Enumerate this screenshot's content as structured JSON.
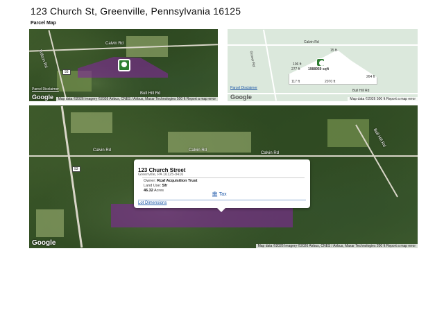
{
  "header": {
    "title": "123 Church St, Greenville, Pennsylvania 16125",
    "subtitle": "Parcel Map"
  },
  "map1": {
    "road_labels": [
      "Calvin Rd",
      "Bull Hill Rd",
      "Wilson Rd"
    ],
    "shield": "93",
    "disclaimer": "Parcel Disclaimer",
    "google": "Google",
    "attribution": "Map data ©2026 Imagery ©2026 Airbus, CNES / Airbus, Maxar Technologies   500 ft   Report a map error"
  },
  "map2": {
    "road_labels": [
      "Calvin Rd",
      "Bull Hill Rd",
      "Grover Rd"
    ],
    "dimensions": [
      "15 ft",
      "106 ft",
      "277 ft",
      "1988959 sqft",
      "2070 ft",
      "117 ft",
      "264 ft"
    ],
    "disclaimer": "Parcel Disclaimer",
    "google": "Google",
    "attribution": "Map data ©2026   500 ft   Report a map error"
  },
  "map3": {
    "road_labels": [
      "Calvin Rd",
      "Calvin Rd",
      "Calvin Rd",
      "Bull Hill Rd"
    ],
    "shield": "93",
    "google": "Google",
    "attribution": "Map data ©2026 Imagery ©2026 Airbus, CNES / Airbus, Maxar Technologies   200 ft   Report a map error"
  },
  "popup": {
    "title": "123 Church Street",
    "address": "Greenville, PA 16125-9416",
    "owner_label": "Owner:",
    "owner_value": "Rcaf Acquisition Trust",
    "land_use_label": "Land Use:",
    "land_use_value": "Sfr",
    "acres_value": "46.32",
    "acres_label": "Acres",
    "tax_label": "Tax",
    "tax_icon": "building-icon",
    "lot_link": "Lot Dimensions"
  },
  "colors": {
    "parcel": "#80289a",
    "link": "#1a56a8",
    "pin": "#2e7d32"
  }
}
